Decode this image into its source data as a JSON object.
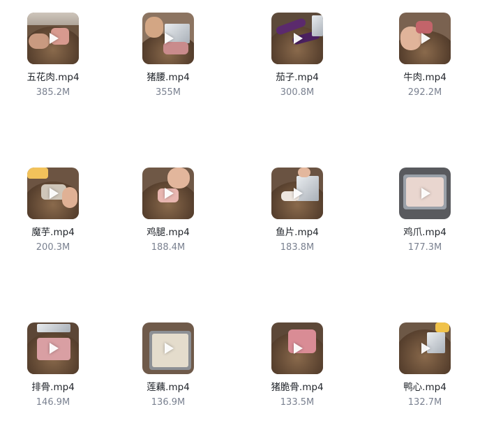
{
  "files": [
    {
      "name": "五花肉.mp4",
      "size": "385.2M"
    },
    {
      "name": "猪腰.mp4",
      "size": "355M"
    },
    {
      "name": "茄子.mp4",
      "size": "300.8M"
    },
    {
      "name": "牛肉.mp4",
      "size": "292.2M"
    },
    {
      "name": "魔芋.mp4",
      "size": "200.3M"
    },
    {
      "name": "鸡腿.mp4",
      "size": "188.4M"
    },
    {
      "name": "鱼片.mp4",
      "size": "183.8M"
    },
    {
      "name": "鸡爪.mp4",
      "size": "177.3M"
    },
    {
      "name": "排骨.mp4",
      "size": "146.9M"
    },
    {
      "name": "莲藕.mp4",
      "size": "136.9M"
    },
    {
      "name": "猪脆骨.mp4",
      "size": "133.5M"
    },
    {
      "name": "鸭心.mp4",
      "size": "132.7M"
    }
  ],
  "icons": {
    "play": "play-icon",
    "thumbnail": "video-thumbnail"
  },
  "colors": {
    "file_name": "#1f2329",
    "file_size": "#7a8190",
    "background": "#ffffff"
  }
}
